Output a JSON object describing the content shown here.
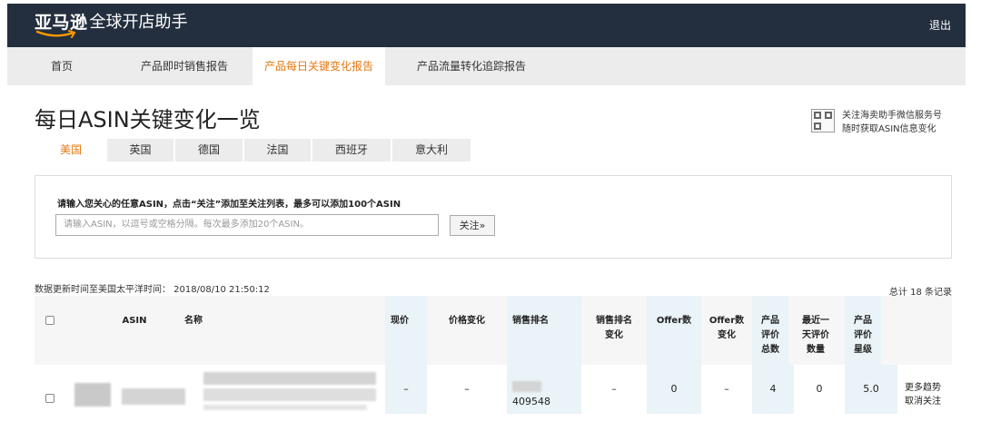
{
  "header": {
    "brand": "亚马逊",
    "subtitle": "全球开店助手",
    "logout": "退出"
  },
  "nav": {
    "items": [
      "首页",
      "产品即时销售报告",
      "产品每日关键变化报告",
      "产品流量转化追踪报告"
    ],
    "active": 2
  },
  "page_title": "每日ASIN关键变化一览",
  "wechat": {
    "line1": "关注海卖助手微信服务号",
    "line2": "随时获取ASIN信息变化"
  },
  "countries": {
    "items": [
      "美国",
      "英国",
      "德国",
      "法国",
      "西班牙",
      "意大利"
    ],
    "active": 0
  },
  "panel": {
    "label": "请输入您关心的任意ASIN，点击“关注”添加至关注列表，最多可以添加100个ASIN",
    "placeholder": "请输入ASIN，以逗号或空格分隔。每次最多添加20个ASIN。",
    "follow_button": "关注»"
  },
  "update_time": "数据更新时间至美国太平洋时间：  2018/08/10 21:50:12",
  "total": "总计  18  条记录",
  "table": {
    "headers": [
      "ASIN",
      "名称",
      "现价",
      "价格变化",
      "销售排名",
      "销售排名\n变化",
      "Offer数",
      "Offer数\n变化",
      "产品\n评价\n总数",
      "最近一\n天评价\n数量",
      "产品\n评价\n星级"
    ],
    "rows": [
      {
        "price": "–",
        "price_change": "–",
        "sales_rank": "409548",
        "rank_change": "–",
        "offers": "0",
        "offer_change": "–",
        "review_total": "4",
        "recent_reviews": "0",
        "rating": "5.0",
        "actions": [
          "更多趋势",
          "取消关注"
        ]
      }
    ]
  },
  "colors": {
    "header_bg": "#232f3e",
    "accent": "#e47911",
    "nav_bg": "#ececec",
    "col_shade": "#eaf3f7"
  }
}
